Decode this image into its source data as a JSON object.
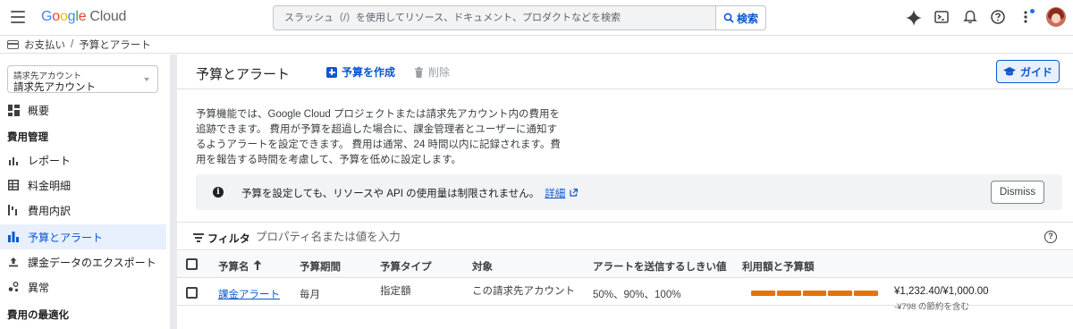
{
  "header": {
    "logo_letters": [
      "G",
      "o",
      "o",
      "g",
      "l",
      "e"
    ],
    "logo_product": "Cloud",
    "search_placeholder": "スラッシュ（/）を使用してリソース、ドキュメント、プロダクトなどを検索",
    "search_button": "検索"
  },
  "breadcrumb": {
    "items": [
      "お支払い",
      "予算とアラート"
    ],
    "separator": "/"
  },
  "sidebar": {
    "account_label": "請求先アカウント",
    "account_value": "請求先アカウント",
    "overview": "概要",
    "section_cost": "費用管理",
    "items": [
      {
        "label": "レポート",
        "icon": "bar-chart-icon"
      },
      {
        "label": "料金明細",
        "icon": "table-icon"
      },
      {
        "label": "費用内訳",
        "icon": "waterfall-icon"
      },
      {
        "label": "予算とアラート",
        "icon": "budget-icon",
        "active": true
      },
      {
        "label": "課金データのエクスポート",
        "icon": "upload-icon"
      },
      {
        "label": "異常",
        "icon": "anomaly-icon"
      }
    ],
    "section_optimize": "費用の最適化"
  },
  "main": {
    "title": "予算とアラート",
    "create_label": "予算を作成",
    "delete_label": "削除",
    "guide_label": "ガイド",
    "intro": "予算機能では、Google Cloud プロジェクトまたは請求先アカウント内の費用を追跡できます。 費用が予算を超過した場合に、課金管理者とユーザーに通知するようアラートを設定できます。 費用は通常、24 時間以内に記録されます。費用を報告する時間を考慮して、予算を低めに設定します。",
    "info_text": "予算を設定しても、リソースや API の使用量は制限されません。",
    "info_link": "詳細",
    "dismiss_label": "Dismiss",
    "filter_label": "フィルタ",
    "filter_placeholder": "プロパティ名または値を入力",
    "columns": {
      "name": "予算名",
      "period": "予算期間",
      "type": "予算タイプ",
      "target": "対象",
      "thresholds": "アラートを送信するしきい値",
      "usage": "利用額と予算額"
    },
    "rows": [
      {
        "name": "課金アラート",
        "period": "毎月",
        "type": "指定額",
        "target": "この請求先アカウント",
        "thresholds": "50%、90%、100%",
        "spend_fraction": 1.0,
        "amount": "¥1,232.40/¥1,000.00",
        "savings": "-¥798 の節約を含む"
      }
    ]
  },
  "colors": {
    "accent": "#0b57d0",
    "bar": "#e8710a",
    "active_nav_bg": "#e8f0fe"
  }
}
